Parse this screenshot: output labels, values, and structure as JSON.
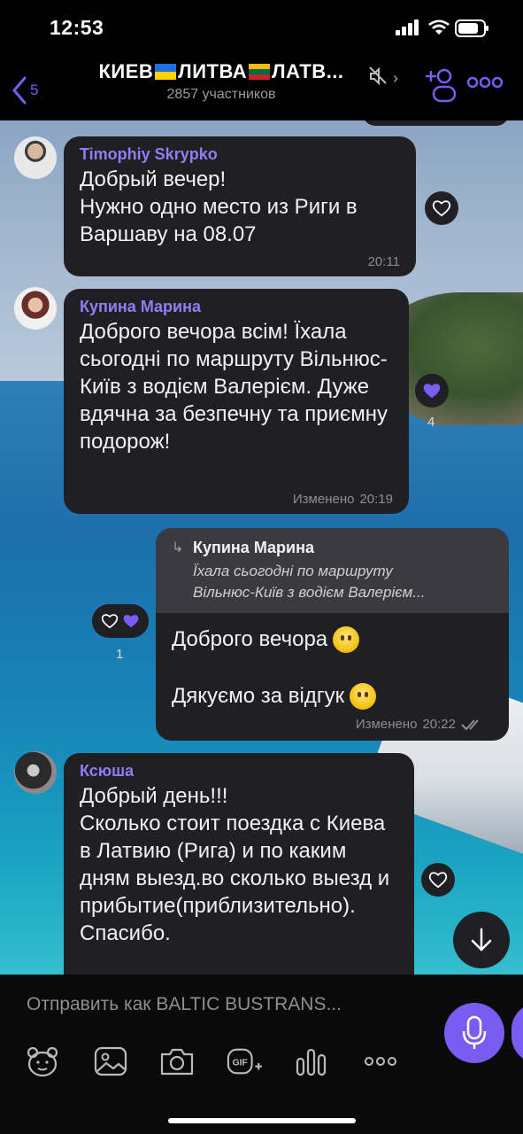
{
  "status_bar": {
    "time": "12:53"
  },
  "header": {
    "back_count": "5",
    "title_part1": "КИЕВ",
    "title_part2": "ЛИТВА",
    "title_part3": "ЛАТВ...",
    "members": "2857 участников"
  },
  "messages": [
    {
      "author": "Timophiy Skrypko",
      "text": "Добрый вечер!\nНужно одно место из Риги в Варшаву на 08.07",
      "time": "20:11"
    },
    {
      "author": "Купина Марина",
      "text": "Доброго вечора всім! Їхала сьогодні по маршруту Вільнюс-Київ з водієм Валерієм. Дуже вдячна за безпечну та приємну подорож!",
      "edited": "Изменено",
      "time": "20:19",
      "reaction_count": "4"
    },
    {
      "reply_to_author": "Купина Марина",
      "reply_to_text": "Їхала сьогодні по маршруту\nВільнюс-Київ з водієм Валерієм...",
      "line1": "Доброго вечора",
      "line2": "Дякуємо за відгук",
      "edited": "Изменено",
      "time": "20:22",
      "reaction_count": "1"
    },
    {
      "author": "Ксюша",
      "text": "Добрый день!!!\nСколько стоит поездка с Киева в Латвию (Рига) и по каким дням выезд.во сколько выезд и прибытие(приблизительно). Спасибо."
    }
  ],
  "composer": {
    "placeholder": "Отправить как BALTIC BUSTRANS..."
  },
  "colors": {
    "accent": "#7b5cf3",
    "bubble": "#1f1f24",
    "author_name": "#8f7ff5"
  },
  "icons": [
    "back-chevron-icon",
    "mute-icon",
    "add-member-icon",
    "more-icon",
    "heart-icon",
    "scroll-down-icon",
    "microphone-icon",
    "sticker-icon",
    "gallery-icon",
    "camera-icon",
    "gif-icon",
    "poll-icon",
    "more-options-icon"
  ]
}
